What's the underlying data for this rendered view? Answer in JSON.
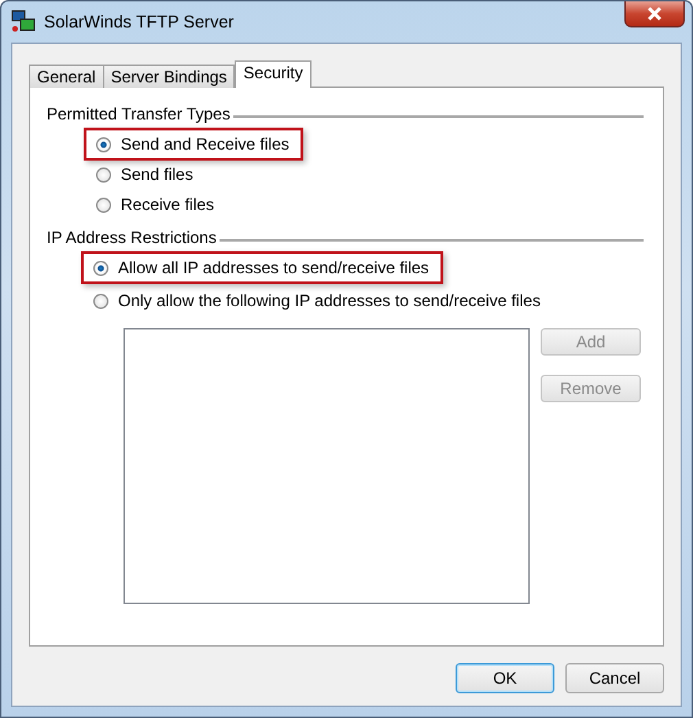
{
  "window": {
    "title": "SolarWinds TFTP Server"
  },
  "tabs": [
    {
      "label": "General",
      "selected": false
    },
    {
      "label": "Server Bindings",
      "selected": false
    },
    {
      "label": "Security",
      "selected": true
    }
  ],
  "groups": [
    {
      "title": "Permitted Transfer Types",
      "options": [
        {
          "label": "Send and Receive files",
          "selected": true,
          "highlighted": true
        },
        {
          "label": "Send files",
          "selected": false,
          "highlighted": false
        },
        {
          "label": "Receive files",
          "selected": false,
          "highlighted": false
        }
      ]
    },
    {
      "title": "IP Address Restrictions",
      "options": [
        {
          "label": "Allow all IP addresses to send/receive files",
          "selected": true,
          "highlighted": true
        },
        {
          "label": "Only allow the following IP addresses to send/receive files",
          "selected": false,
          "highlighted": false
        }
      ]
    }
  ],
  "list_buttons": [
    {
      "label": "Add",
      "disabled": true
    },
    {
      "label": "Remove",
      "disabled": true
    }
  ],
  "buttons": [
    {
      "label": "OK",
      "default": true
    },
    {
      "label": "Cancel",
      "default": false
    }
  ]
}
